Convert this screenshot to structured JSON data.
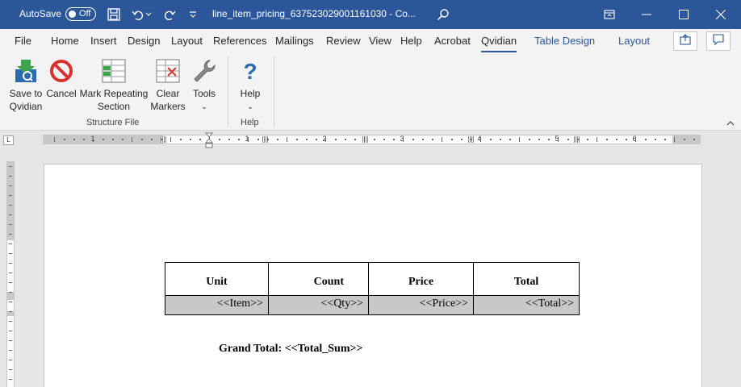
{
  "titlebar": {
    "autosave_label": "AutoSave",
    "autosave_state": "Off",
    "doc_title": "line_item_pricing_637523029001161030  -  Co..."
  },
  "tabs": [
    "File",
    "Home",
    "Insert",
    "Design",
    "Layout",
    "References",
    "Mailings",
    "Review",
    "View",
    "Help",
    "Acrobat",
    "Qvidian",
    "Table Design",
    "Layout"
  ],
  "active_tab": "Qvidian",
  "ribbon": {
    "save": [
      "Save to",
      "Qvidian"
    ],
    "cancel": "Cancel",
    "mark": [
      "Mark Repeating",
      "Section"
    ],
    "clear": [
      "Clear",
      "Markers"
    ],
    "tools": "Tools",
    "help": "Help",
    "group_structure": "Structure File",
    "group_help": "Help"
  },
  "ruler": {
    "numbers": [
      "1",
      "1",
      "2",
      "3",
      "4",
      "5",
      "6"
    ],
    "corner": "L"
  },
  "document": {
    "headers": [
      "Unit",
      "Count",
      "Price",
      "Total"
    ],
    "row": [
      "<<Item>>",
      "<<Qty>>",
      "<<Price>>",
      "<<Total>>"
    ],
    "grand_total": "Grand Total: <<Total_Sum>>"
  },
  "colors": {
    "title_bar": "#2b579a",
    "accent": "#2b579a",
    "placeholder_row": "#c8c8c8"
  },
  "icons": [
    "save-icon",
    "undo-icon",
    "redo-icon",
    "search-icon",
    "restore-ribbon-icon",
    "minimize-icon",
    "maximize-icon",
    "close-icon",
    "share-icon",
    "comment-icon",
    "save-to-qvidian-icon",
    "cancel-icon",
    "mark-repeating-section-icon",
    "clear-markers-icon",
    "tools-wrench-icon",
    "help-question-icon"
  ]
}
